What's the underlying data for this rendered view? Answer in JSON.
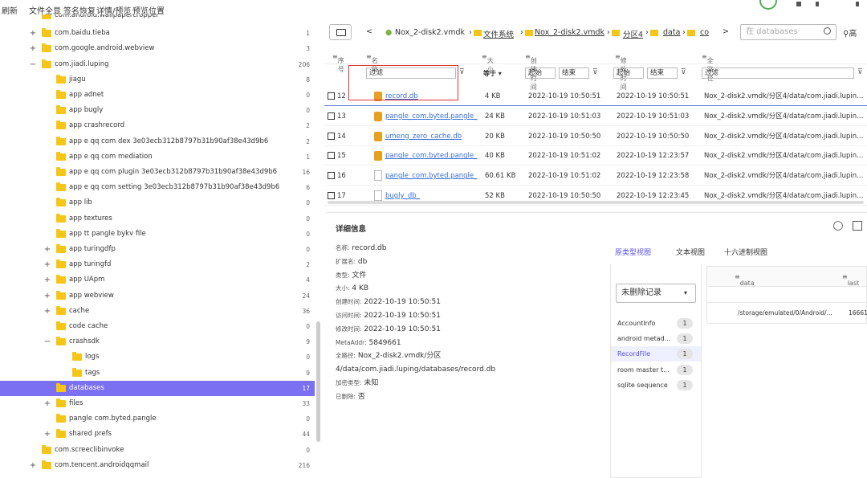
{
  "menu": {
    "refresh": "刷新",
    "all_files": "文件全显",
    "sign_restore": "签名恢复",
    "detail_preview": "详情/预览",
    "preview_pos": "预览位置"
  },
  "tree": [
    {
      "label": "com.android.wallpapercropper",
      "count": "",
      "exp": "",
      "indent": 1
    },
    {
      "label": "com.baidu.tieba",
      "count": "1",
      "exp": "+",
      "indent": 1
    },
    {
      "label": "com.google.android.webview",
      "count": "3",
      "exp": "+",
      "indent": 1
    },
    {
      "label": "com.jiadi.luping",
      "count": "206",
      "exp": "−",
      "indent": 1
    },
    {
      "label": "jiagu",
      "count": "8",
      "exp": "",
      "indent": 2
    },
    {
      "label": "app adnet",
      "count": "0",
      "exp": "",
      "indent": 2
    },
    {
      "label": "app bugly",
      "count": "0",
      "exp": "",
      "indent": 2
    },
    {
      "label": "app crashrecord",
      "count": "2",
      "exp": "",
      "indent": 2
    },
    {
      "label": "app e qq com dex 3e03ecb312b8797b31b90af38e43d9b6",
      "count": "2",
      "exp": "",
      "indent": 2
    },
    {
      "label": "app e qq com mediation",
      "count": "1",
      "exp": "",
      "indent": 2
    },
    {
      "label": "app e qq com plugin 3e03ecb312b8797b31b90af38e43d9b6",
      "count": "16",
      "exp": "",
      "indent": 2
    },
    {
      "label": "app e qq com setting 3e03ecb312b8797b31b90af38e43d9b6",
      "count": "6",
      "exp": "",
      "indent": 2
    },
    {
      "label": "app lib",
      "count": "0",
      "exp": "",
      "indent": 2
    },
    {
      "label": "app textures",
      "count": "0",
      "exp": "",
      "indent": 2
    },
    {
      "label": "app tt pangle bykv file",
      "count": "0",
      "exp": "",
      "indent": 2
    },
    {
      "label": "app turingdfp",
      "count": "0",
      "exp": "+",
      "indent": 2
    },
    {
      "label": "app turingfd",
      "count": "2",
      "exp": "+",
      "indent": 2
    },
    {
      "label": "app UApm",
      "count": "4",
      "exp": "+",
      "indent": 2
    },
    {
      "label": "app webview",
      "count": "24",
      "exp": "+",
      "indent": 2
    },
    {
      "label": "cache",
      "count": "36",
      "exp": "+",
      "indent": 2
    },
    {
      "label": "code cache",
      "count": "0",
      "exp": "",
      "indent": 2
    },
    {
      "label": "crashsdk",
      "count": "9",
      "exp": "−",
      "indent": 2
    },
    {
      "label": "logs",
      "count": "0",
      "exp": "",
      "indent": 3
    },
    {
      "label": "tags",
      "count": "9",
      "exp": "",
      "indent": 3
    },
    {
      "label": "databases",
      "count": "17",
      "exp": "",
      "indent": 2,
      "selected": true
    },
    {
      "label": "files",
      "count": "33",
      "exp": "+",
      "indent": 2
    },
    {
      "label": "pangle com.byted.pangle",
      "count": "0",
      "exp": "",
      "indent": 2
    },
    {
      "label": "shared prefs",
      "count": "44",
      "exp": "+",
      "indent": 2
    },
    {
      "label": "com.screeclibinvoke",
      "count": "0",
      "exp": "",
      "indent": 1
    },
    {
      "label": "com.tencent.androidqqmail",
      "count": "216",
      "exp": "+",
      "indent": 1
    }
  ],
  "path": {
    "nav_back": "<",
    "items": [
      "Nox_2-disk2.vmdk",
      "文件系统",
      "Nox_2-disk2.vmdk",
      "分区4",
      "data",
      "co"
    ],
    "nav_fwd": ">",
    "search_placeholder": "在 databases",
    "advanced": "高"
  },
  "columns": {
    "seq": "序号",
    "name": "名称",
    "size": "大小",
    "created": "创建时间",
    "modified": "修改时间",
    "fullpath": "全路径"
  },
  "filters": {
    "name": "过滤",
    "size_op": "等于",
    "created_start": "起始",
    "created_end": "结束",
    "modified_start": "起始",
    "modified_end": "结束",
    "path": "过滤"
  },
  "files": [
    {
      "seq": "12",
      "name": "record.db",
      "type": "db",
      "size": "4 KB",
      "created": "2022-10-19 10:50:51",
      "modified": "2022-10-19 10:50:51",
      "path": "Nox_2-disk2.vmdk/分区4/data/com.jiadi.lupin..."
    },
    {
      "seq": "13",
      "name": "pangle_com.byted.pangle_",
      "type": "db",
      "size": "24 KB",
      "created": "2022-10-19 10:51:03",
      "modified": "2022-10-19 10:51:03",
      "path": "Nox_2-disk2.vmdk/分区4/data/com.jiadi.lupin..."
    },
    {
      "seq": "14",
      "name": "umeng_zero_cache.db",
      "type": "db",
      "size": "20 KB",
      "created": "2022-10-19 10:50:50",
      "modified": "2022-10-19 10:50:50",
      "path": "Nox_2-disk2.vmdk/分区4/data/com.jiadi.lupin..."
    },
    {
      "seq": "15",
      "name": "pangle_com.byted.pangle_",
      "type": "db",
      "size": "40 KB",
      "created": "2022-10-19 10:51:02",
      "modified": "2022-10-19 12:23:57",
      "path": "Nox_2-disk2.vmdk/分区4/data/com.jiadi.lupin..."
    },
    {
      "seq": "16",
      "name": "pangle_com.byted.pangle_",
      "type": "file",
      "size": "60.61 KB",
      "created": "2022-10-19 10:51:02",
      "modified": "2022-10-19 12:23:58",
      "path": "Nox_2-disk2.vmdk/分区4/data/com.jiadi.lupin..."
    },
    {
      "seq": "17",
      "name": "bugly_db_",
      "type": "file",
      "size": "52 KB",
      "created": "2022-10-19 10:50:50",
      "modified": "2022-10-19 12:23:45",
      "path": "Nox_2-disk2.vmdk/分区4/data/com.jiadi.lupin..."
    }
  ],
  "detail": {
    "title": "详细信息",
    "info": [
      {
        "k": "名称:",
        "v": "record.db"
      },
      {
        "k": "扩展名:",
        "v": "db"
      },
      {
        "k": "类型:",
        "v": "文件"
      },
      {
        "k": "大小:",
        "v": "4 KB"
      },
      {
        "k": "创建时间:",
        "v": "2022-10-19 10:50:51"
      },
      {
        "k": "访问时间:",
        "v": "2022-10-19 10:50:51"
      },
      {
        "k": "修改时间:",
        "v": "2022-10-19 10:50:51"
      },
      {
        "k": "MetaAddr:",
        "v": "5849661"
      },
      {
        "k": "全路径:",
        "v": "Nox_2-disk2.vmdk/分区"
      },
      {
        "k": "",
        "v": "4/data/com.jiadi.luping/databases/record.db"
      },
      {
        "k": "加密类型:",
        "v": "未知"
      },
      {
        "k": "已删除:",
        "v": "否"
      }
    ],
    "tabs": [
      "原类型视图",
      "文本视图",
      "十六进制视图"
    ],
    "dropdown": "未删除记录",
    "tables": [
      {
        "name": "AccountInfo",
        "count": "1"
      },
      {
        "name": "android metad...",
        "count": "1"
      },
      {
        "name": "RecordFile",
        "count": "1",
        "selected": true
      },
      {
        "name": "room master t...",
        "count": "1"
      },
      {
        "name": "sqlite sequence",
        "count": "1"
      }
    ],
    "grid": {
      "col1": "data",
      "col2": "last",
      "row_data": "/storage/emulated/0/Android/...",
      "row_last": "16661"
    }
  }
}
